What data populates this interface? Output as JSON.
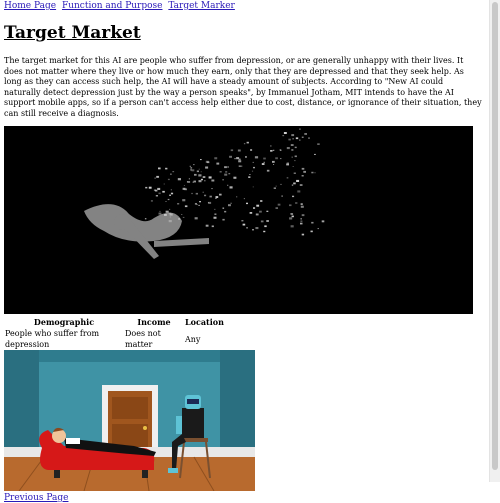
{
  "nav": [
    {
      "label": "Home Page"
    },
    {
      "label": "Function and Purpose"
    },
    {
      "label": "Target Marker"
    }
  ],
  "title": "Target Market",
  "paragraph": "The target market for this AI are people who suffer from depression, or are generally unhappy with their lives. It does not matter where they live or how much they earn, only that they are depressed and that they seek help. As long as they can access such help, the AI will have a steady amount of subjects. According to \"New AI could naturally detect depression just by the way a person speaks\", by Immanuel Jotham, MIT intends to have the AI support mobile apps, so if a person can't access help either due to cost, distance, or ignorance of their situation, they can still receive a diagnosis.",
  "table": {
    "headers": [
      "Demographic",
      "Income",
      "Location"
    ],
    "rows": [
      [
        "People who suffer from depression",
        "Does not matter",
        "Any"
      ]
    ]
  },
  "footer_link": "Previous Page",
  "colors": {
    "link": "#2a1ab8",
    "wall": "#3b8fa0",
    "couch": "#d61818",
    "floor": "#b86a2e"
  }
}
